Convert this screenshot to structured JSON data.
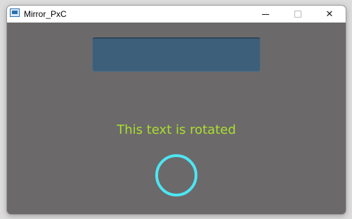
{
  "window": {
    "title": "Mirror_PxC",
    "controls": {
      "minimize_icon": "minimize-icon",
      "maximize_icon": "maximize-icon",
      "close_icon": "close-icon",
      "close_glyph": "✕"
    },
    "app_icon": "app-window-icon"
  },
  "content": {
    "rotated_text": "This text is rotated",
    "colors": {
      "background": "#6c696b",
      "box": "#3e5f79",
      "text": "#a8e02c",
      "ring": "#4de6f2"
    }
  }
}
